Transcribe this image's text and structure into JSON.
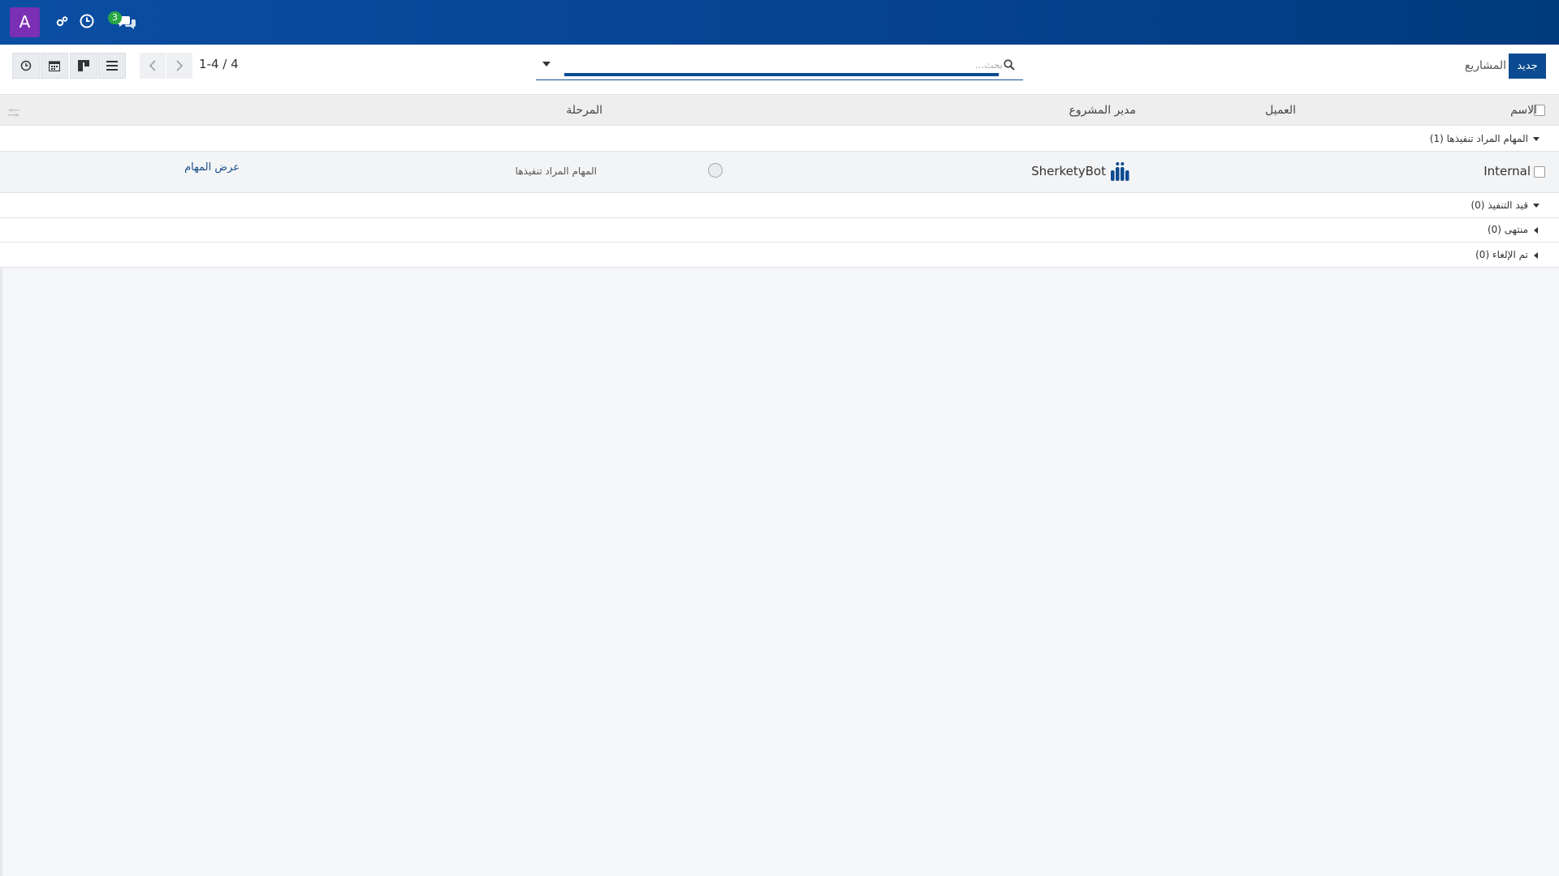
{
  "topbar": {
    "avatar_letter": "A",
    "messages_badge": "3",
    "icons": [
      "settings-gears-icon",
      "clock-icon",
      "chat-icon"
    ]
  },
  "control_panel": {
    "breadcrumb": "المشاريع",
    "new_button": "جديد",
    "search_placeholder": "بحث...",
    "pager": "1-4 / 4",
    "views": [
      "list-view-icon",
      "kanban-view-icon",
      "calendar-view-icon",
      "activity-view-icon"
    ]
  },
  "table": {
    "columns": {
      "name": "الاسم",
      "customer": "العميل",
      "project_manager": "مدير المشروع",
      "stage": "المرحلة"
    },
    "groups": [
      {
        "label": "المهام المراد تنفيذها (1)",
        "expanded": true
      },
      {
        "label": "قيد التنفيذ (0)",
        "expanded": true
      },
      {
        "label": "منتهى (0)",
        "expanded": false
      },
      {
        "label": "تم الإلغاء (0)",
        "expanded": false
      }
    ],
    "rows": [
      {
        "name": "Internal",
        "project_manager": "SherketyBot",
        "stage": "المهام المراد تنفيذها",
        "action": "عرض المهام"
      }
    ]
  },
  "colors": {
    "topbar": "#064390",
    "primary": "#0b4b92",
    "avatar": "#7a2fb5",
    "badge": "#28a745"
  }
}
